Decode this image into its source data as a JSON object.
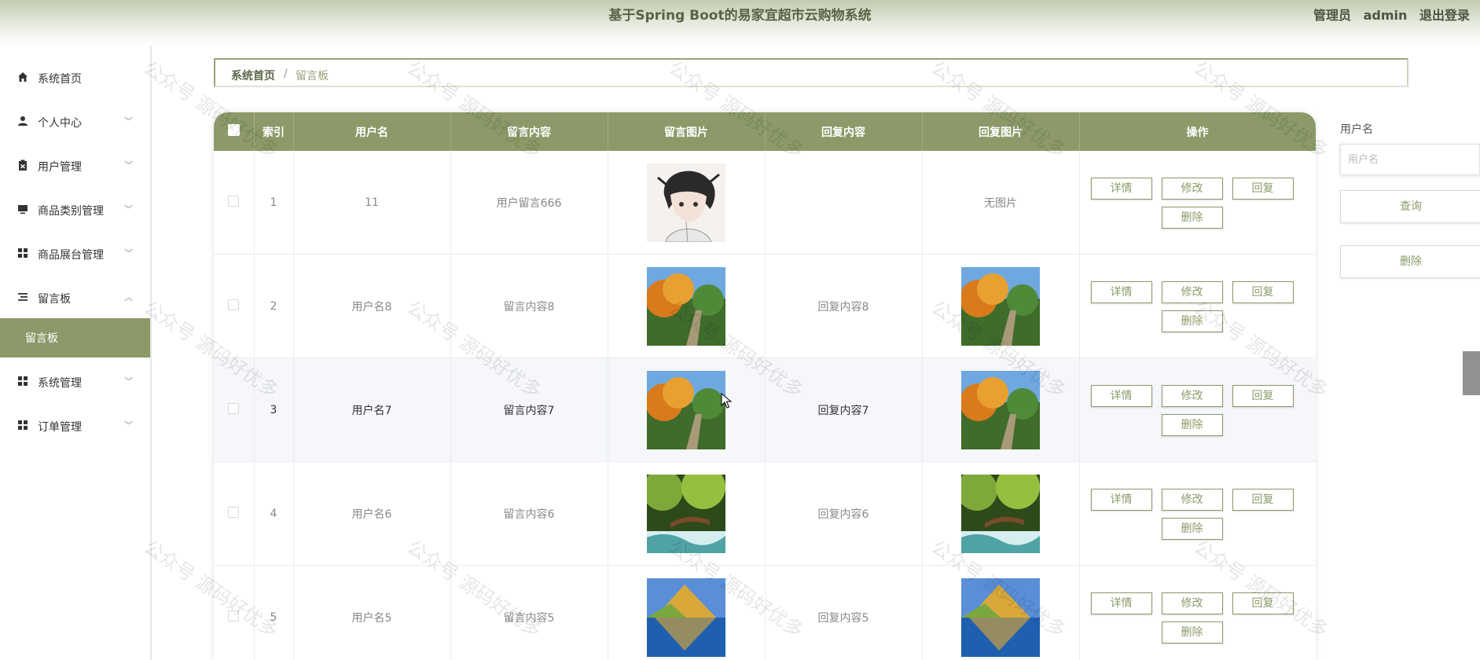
{
  "header": {
    "title": "基于Spring Boot的易家宜超市云购物系统",
    "role": "管理员",
    "username": "admin",
    "logout": "退出登录"
  },
  "sidebar": {
    "items": [
      {
        "label": "系统首页",
        "icon": "home-icon"
      },
      {
        "label": "个人中心",
        "icon": "user-icon"
      },
      {
        "label": "用户管理",
        "icon": "clipboard-icon"
      },
      {
        "label": "商品类别管理",
        "icon": "monitor-icon"
      },
      {
        "label": "商品展台管理",
        "icon": "grid-icon"
      },
      {
        "label": "留言板",
        "icon": "list-icon"
      },
      {
        "label": "系统管理",
        "icon": "grid-icon"
      },
      {
        "label": "订单管理",
        "icon": "grid-icon"
      }
    ],
    "active_sub": "留言板"
  },
  "breadcrumb": {
    "home": "系统首页",
    "sep": "/",
    "current": "留言板"
  },
  "table": {
    "headers": [
      "索引",
      "用户名",
      "留言内容",
      "留言图片",
      "回复内容",
      "回复图片",
      "操作"
    ],
    "rows": [
      {
        "index": "1",
        "username": "11",
        "content": "用户留言666",
        "reply": "",
        "reply_image_text": "无图片"
      },
      {
        "index": "2",
        "username": "用户名8",
        "content": "留言内容8",
        "reply": "回复内容8",
        "reply_image_text": ""
      },
      {
        "index": "3",
        "username": "用户名7",
        "content": "留言内容7",
        "reply": "回复内容7",
        "reply_image_text": ""
      },
      {
        "index": "4",
        "username": "用户名6",
        "content": "留言内容6",
        "reply": "回复内容6",
        "reply_image_text": ""
      },
      {
        "index": "5",
        "username": "用户名5",
        "content": "留言内容5",
        "reply": "回复内容5",
        "reply_image_text": ""
      }
    ],
    "actions": {
      "detail": "详情",
      "edit": "修改",
      "reply": "回复",
      "delete": "删除"
    }
  },
  "search": {
    "label": "用户名",
    "placeholder": "用户名",
    "query_button": "查询",
    "delete_button": "删除"
  },
  "watermark": "公众号 源码好优多",
  "colors": {
    "accent": "#8b9a68",
    "header_text": "#5a6248"
  }
}
